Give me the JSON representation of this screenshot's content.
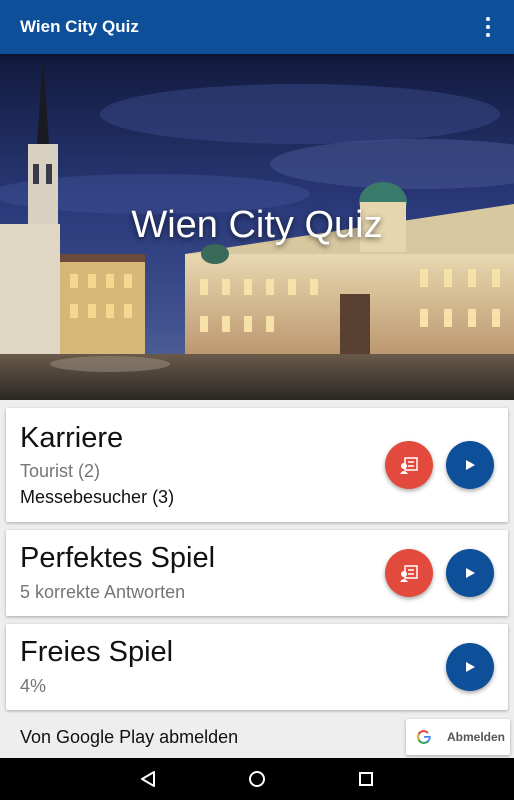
{
  "appbar": {
    "title": "Wien City Quiz",
    "menu_icon": "more-vert-icon"
  },
  "hero": {
    "title": "Wien City Quiz",
    "image": "vienna-hofburg-michaelerplatz-night"
  },
  "cards": [
    {
      "title": "Karriere",
      "subtitle": "Tourist (2)",
      "subtitle2": "Messebesucher (3)",
      "leaderboard_icon": "leaderboard-icon",
      "play_icon": "play-icon"
    },
    {
      "title": "Perfektes Spiel",
      "subtitle": "5 korrekte Antworten",
      "leaderboard_icon": "leaderboard-icon",
      "play_icon": "play-icon"
    },
    {
      "title": "Freies Spiel",
      "subtitle": "4%",
      "play_icon": "play-icon"
    }
  ],
  "footer": {
    "text": "Von Google Play abmelden",
    "button_label": "Abmelden",
    "button_icon": "google-g-icon"
  },
  "navbar": {
    "back_icon": "back-icon",
    "home_icon": "home-icon",
    "recents_icon": "recents-icon"
  },
  "colors": {
    "primary": "#0d4f98",
    "accent_red": "#e14a3c",
    "background": "#eeeeee"
  }
}
